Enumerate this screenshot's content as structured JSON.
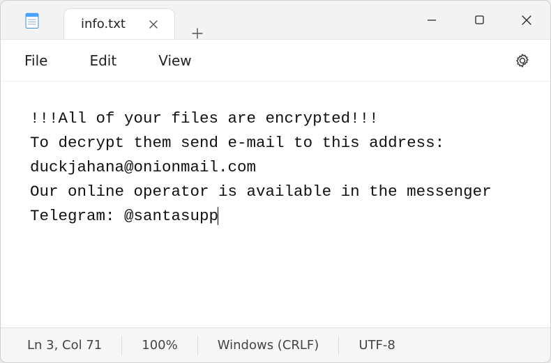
{
  "tab": {
    "title": "info.txt"
  },
  "menus": {
    "file": "File",
    "edit": "Edit",
    "view": "View"
  },
  "document": {
    "text": "!!!All of your files are encrypted!!!\nTo decrypt them send e-mail to this address: duckjahana@onionmail.com\nOur online operator is available in the messenger Telegram: @santasupp"
  },
  "status": {
    "position": "Ln 3, Col 71",
    "zoom": "100%",
    "line_ending": "Windows (CRLF)",
    "encoding": "UTF-8"
  }
}
